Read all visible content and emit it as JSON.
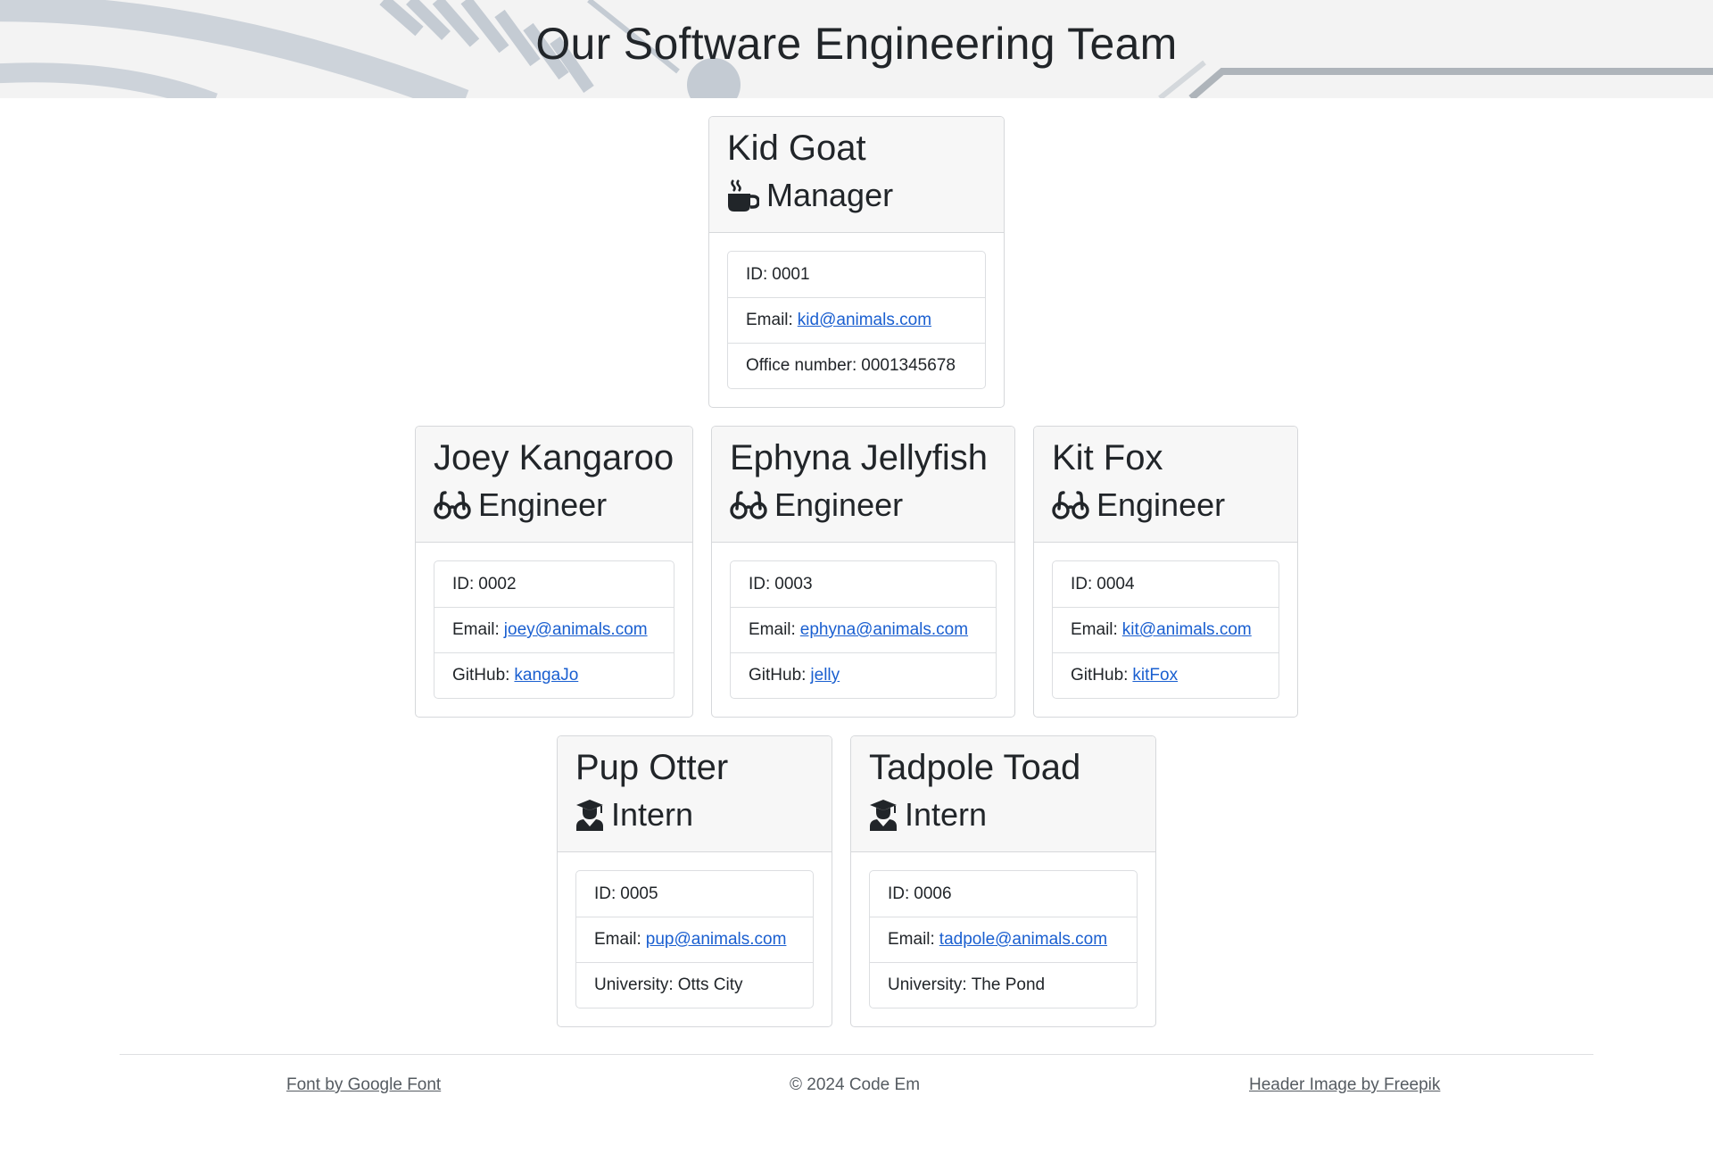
{
  "header": {
    "title": "Our Software Engineering Team"
  },
  "team": [
    {
      "name": "Kid Goat",
      "role": "Manager",
      "role_icon": "coffee-mug-icon",
      "id_label": "ID:",
      "id": "0001",
      "email_label": "Email:",
      "email": "kid@animals.com",
      "extra_label": "Office number:",
      "extra": "0001345678"
    },
    {
      "name": "Joey Kangaroo",
      "role": "Engineer",
      "role_icon": "glasses-icon",
      "id_label": "ID:",
      "id": "0002",
      "email_label": "Email:",
      "email": "joey@animals.com",
      "extra_label": "GitHub:",
      "extra": "kangaJo"
    },
    {
      "name": "Ephyna Jellyfish",
      "role": "Engineer",
      "role_icon": "glasses-icon",
      "id_label": "ID:",
      "id": "0003",
      "email_label": "Email:",
      "email": "ephyna@animals.com",
      "extra_label": "GitHub:",
      "extra": "jelly"
    },
    {
      "name": "Kit Fox",
      "role": "Engineer",
      "role_icon": "glasses-icon",
      "id_label": "ID:",
      "id": "0004",
      "email_label": "Email:",
      "email": "kit@animals.com",
      "extra_label": "GitHub:",
      "extra": "kitFox"
    },
    {
      "name": "Pup Otter",
      "role": "Intern",
      "role_icon": "graduate-icon",
      "id_label": "ID:",
      "id": "0005",
      "email_label": "Email:",
      "email": "pup@animals.com",
      "extra_label": "University:",
      "extra": "Otts City"
    },
    {
      "name": "Tadpole Toad",
      "role": "Intern",
      "role_icon": "graduate-icon",
      "id_label": "ID:",
      "id": "0006",
      "email_label": "Email:",
      "email": "tadpole@animals.com",
      "extra_label": "University:",
      "extra": "The Pond"
    }
  ],
  "footer": {
    "font_credit": "Font by Google Font",
    "copyright": "© 2024 Code Em",
    "image_credit": "Header Image by Freepik"
  },
  "colors": {
    "link": "#1a5fd0",
    "card_header_bg": "#f7f7f7",
    "header_bg": "#f3f3f3"
  }
}
